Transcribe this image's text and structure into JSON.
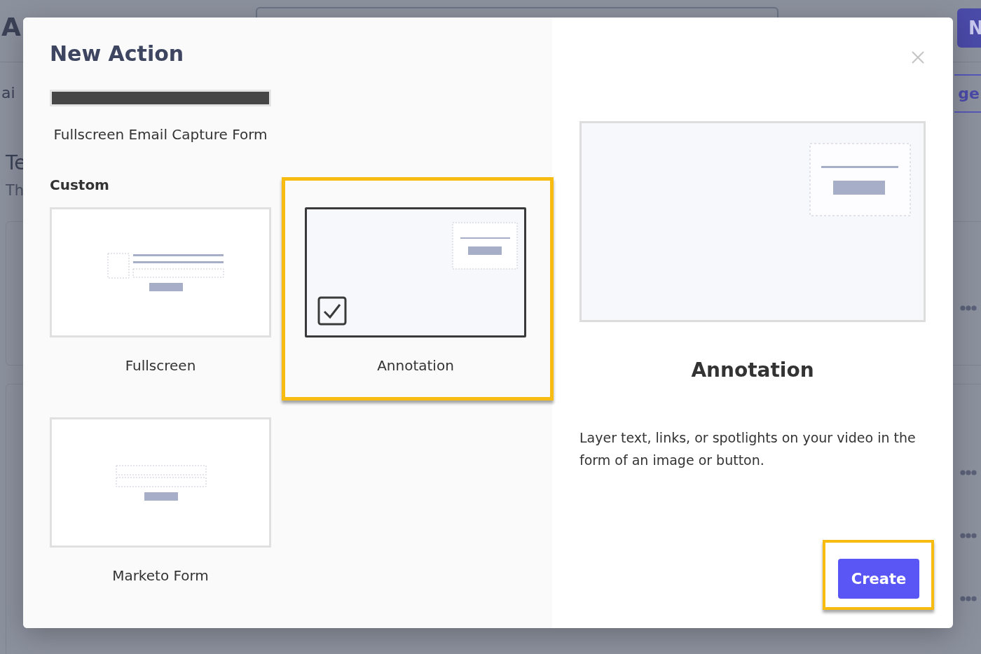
{
  "background": {
    "page_title": "A",
    "tab": "ai",
    "active_tab": "ge",
    "section_title": "Te",
    "section_text": "Th",
    "new_button": "N"
  },
  "dialog": {
    "title": "New Action",
    "templates": [
      {
        "label": "Fullscreen Email Capture Form"
      }
    ],
    "custom_heading": "Custom",
    "options": [
      {
        "kind": "fullscreen",
        "label": "Fullscreen",
        "selected": false
      },
      {
        "kind": "annotation",
        "label": "Annotation",
        "selected": true
      },
      {
        "kind": "form",
        "label": "Marketo Form",
        "selected": false
      }
    ],
    "preview": {
      "kind": "annotation",
      "title": "Annotation",
      "description": "Layer text, links, or spotlights on your video in the form of an image or button."
    },
    "create_button": {
      "label": "Create",
      "highlighted": true
    }
  }
}
